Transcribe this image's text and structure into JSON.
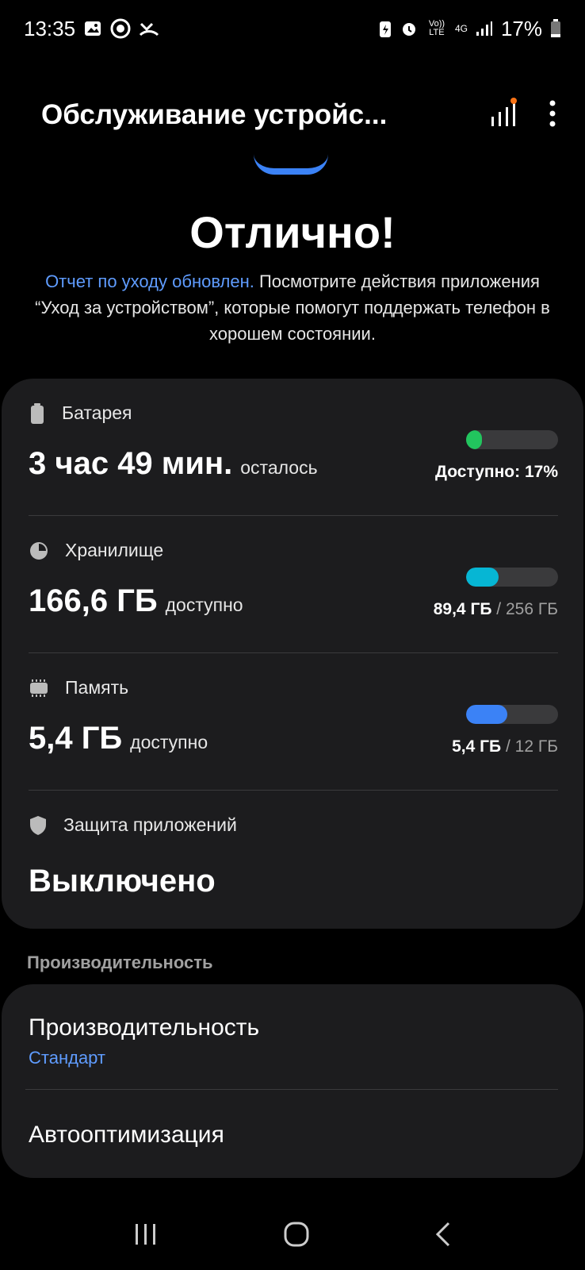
{
  "status": {
    "time": "13:35",
    "battery": "17%",
    "volte": "Vo)) LTE",
    "net": "4G"
  },
  "header": {
    "title": "Обслуживание устройс..."
  },
  "hero": {
    "title": "Отлично!",
    "link_text": "Отчет по уходу обновлен.",
    "description": " Посмотрите действия приложения “Уход за устройством”, которые помогут поддержать телефон в хорошем состоянии."
  },
  "items": {
    "battery": {
      "label": "Батарея",
      "value": "3 час 49 мин.",
      "suffix": "осталось",
      "right": "Доступно: 17%",
      "level": 0.17,
      "color": "#22c55e",
      "icon": "battery-icon"
    },
    "storage": {
      "label": "Хранилище",
      "value": "166,6 ГБ",
      "suffix": "доступно",
      "used": "89,4 ГБ",
      "sep": " / ",
      "total": "256 ГБ",
      "level": 0.35,
      "color": "#06b6d4",
      "icon": "pie-chart-icon"
    },
    "memory": {
      "label": "Память",
      "value": "5,4 ГБ",
      "suffix": "доступно",
      "used": "5,4 ГБ",
      "sep": " / ",
      "total": "12 ГБ",
      "level": 0.45,
      "color": "#3b82f6",
      "icon": "memory-chip-icon"
    },
    "protection": {
      "label": "Защита приложений",
      "value": "Выключено",
      "icon": "shield-icon"
    }
  },
  "performance": {
    "section_label": "Производительность",
    "title": "Производительность",
    "subtitle": "Стандарт",
    "auto_title": "Автооптимизация"
  },
  "colors": {
    "accent": "#5f9cff",
    "card": "#1c1c1e"
  }
}
